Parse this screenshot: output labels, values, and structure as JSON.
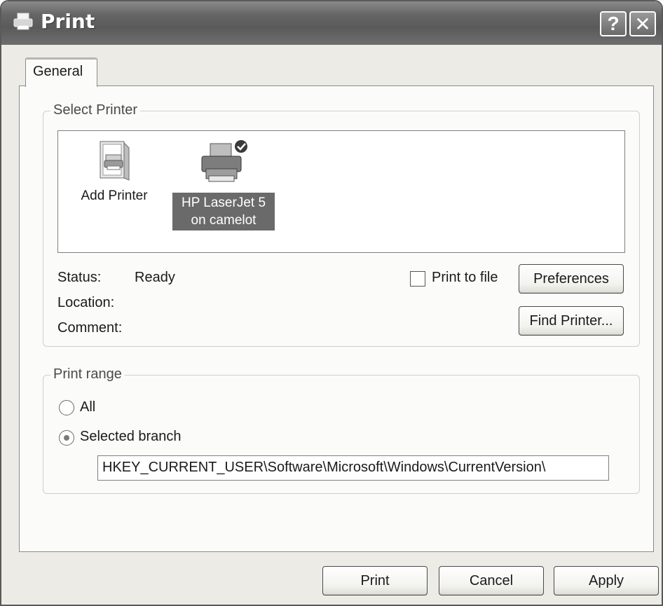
{
  "window": {
    "title": "Print",
    "help_button": "?",
    "close_button": "✕"
  },
  "tabs": [
    {
      "label": "General"
    }
  ],
  "select_printer": {
    "legend": "Select Printer",
    "printers": [
      {
        "label": "Add Printer",
        "icon": "add-printer-icon"
      },
      {
        "label_line1": "HP LaserJet 5",
        "label_line2": "on camelot",
        "icon": "printer-icon",
        "selected": true
      }
    ],
    "status_label": "Status:",
    "status_value": "Ready",
    "location_label": "Location:",
    "comment_label": "Comment:",
    "print_to_file_label": "Print to file",
    "preferences_button": "Preferences",
    "find_printer_button": "Find Printer..."
  },
  "print_range": {
    "legend": "Print range",
    "options": [
      {
        "label": "All",
        "checked": false
      },
      {
        "label": "Selected branch",
        "checked": true
      }
    ],
    "branch_value": "HKEY_CURRENT_USER\\Software\\Microsoft\\Windows\\CurrentVersion\\"
  },
  "footer": {
    "print_button": "Print",
    "cancel_button": "Cancel",
    "apply_button": "Apply"
  }
}
